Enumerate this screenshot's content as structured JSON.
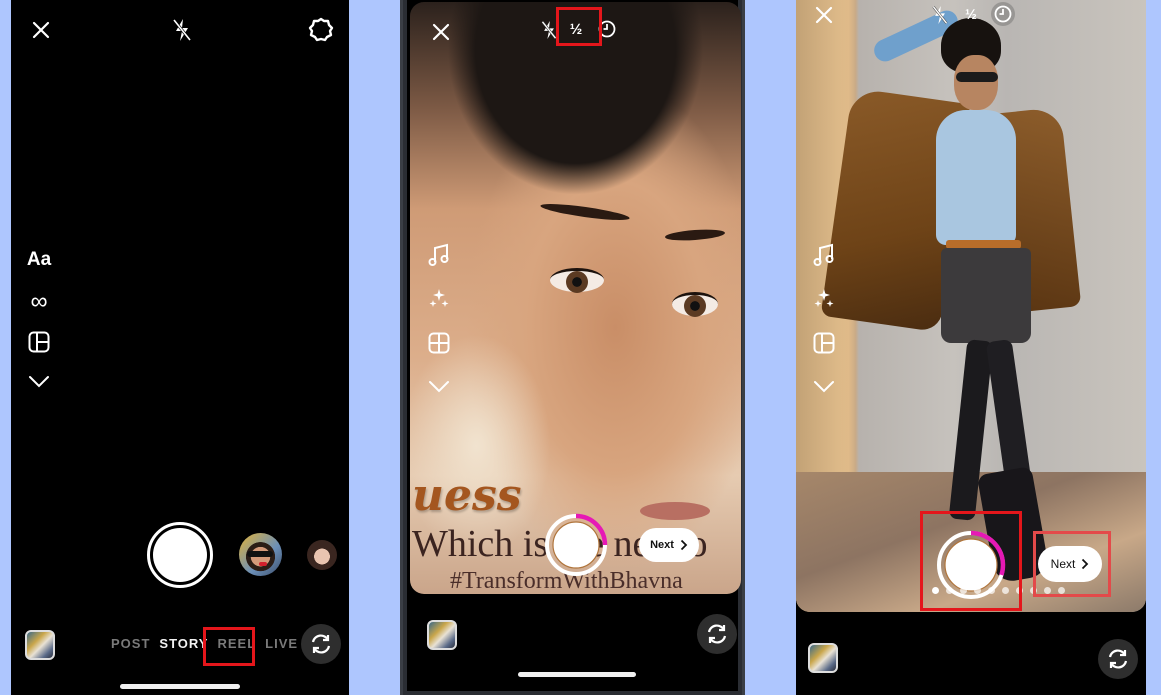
{
  "screens": [
    {
      "id": "camera-story",
      "top_bar": {
        "close_icon": "close-icon",
        "flash_icon": "flash-off-icon",
        "settings_icon": "settings-gear-icon"
      },
      "side_tools": [
        {
          "icon": "text-tool-icon",
          "label": "Aa"
        },
        {
          "icon": "boomerang-icon",
          "label": "∞"
        },
        {
          "icon": "layout-icon",
          "label": ""
        },
        {
          "icon": "chevron-down-icon",
          "label": ""
        }
      ],
      "modes": [
        "POST",
        "STORY",
        "REEL",
        "LIVE"
      ],
      "active_mode": "STORY",
      "highlighted_mode": "REEL",
      "highlight_color": "#e4161b"
    },
    {
      "id": "reel-recording-speed",
      "top_bar": {
        "close_icon": "close-icon",
        "flash_icon": "flash-off-icon",
        "speed_label": "½",
        "timer_icon": "timer-icon"
      },
      "side_tools": [
        {
          "icon": "music-icon"
        },
        {
          "icon": "effects-sparkle-icon"
        },
        {
          "icon": "layout-icon"
        },
        {
          "icon": "chevron-down-icon"
        }
      ],
      "overlay_text": {
        "script": "uess",
        "line": "Which is the next o",
        "hashtag": "#TransformWithBhavna"
      },
      "next_label": "Next",
      "record_progress": 0.25,
      "progress_color": "#e619b5",
      "highlighted": "speed-button"
    },
    {
      "id": "reel-recording-next",
      "top_bar": {
        "close_icon": "close-icon",
        "flash_icon": "flash-off-icon",
        "speed_label": "½",
        "timer_icon": "timer-icon"
      },
      "side_tools": [
        {
          "icon": "music-icon"
        },
        {
          "icon": "effects-sparkle-icon"
        },
        {
          "icon": "layout-icon"
        },
        {
          "icon": "chevron-down-icon"
        }
      ],
      "next_label": "Next",
      "record_progress": 0.3,
      "progress_color": "#e619b5",
      "clip_dots": 10,
      "highlighted": [
        "record-button",
        "next-button"
      ]
    }
  ]
}
